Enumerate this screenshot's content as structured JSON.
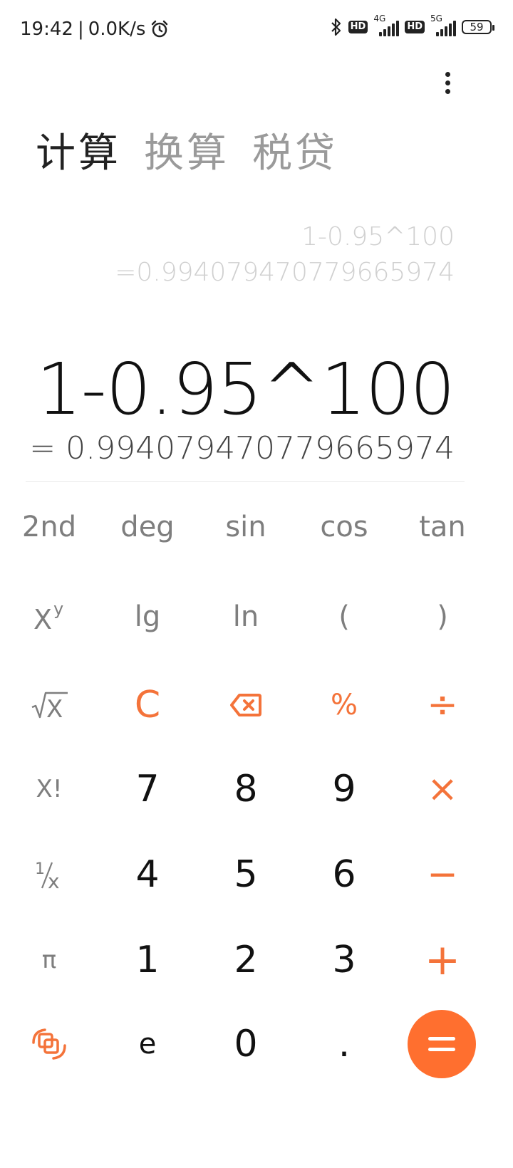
{
  "status_bar": {
    "time": "19:42",
    "separator": "|",
    "net_speed": "0.0K/s",
    "hd_label": "HD",
    "network_1": "4G",
    "network_2": "5G",
    "battery": "59"
  },
  "tabs": [
    {
      "label": "计算",
      "active": true
    },
    {
      "label": "换算",
      "active": false
    },
    {
      "label": "税贷",
      "active": false
    }
  ],
  "history": {
    "expression": "1-0.95^100",
    "result": "=0.994079470779665974"
  },
  "display": {
    "expression": "1-0.95^100",
    "result": "= 0.994079470779665974"
  },
  "keys": {
    "row1": [
      "2nd",
      "deg",
      "sin",
      "cos",
      "tan"
    ],
    "row2": [
      "lg",
      "ln",
      "(",
      ")"
    ],
    "clear": "C",
    "percent": "%",
    "divide": "÷",
    "factorial": "X!",
    "multiply": "×",
    "minus": "−",
    "pi": "π",
    "plus": "+",
    "e": "e",
    "dot": ".",
    "digits": [
      "7",
      "8",
      "9",
      "4",
      "5",
      "6",
      "1",
      "2",
      "3",
      "0"
    ]
  },
  "colors": {
    "accent": "#ff6f2f",
    "operator": "#f4733a"
  },
  "icons": {
    "bluetooth": "bluetooth-icon",
    "alarm": "alarm-icon",
    "menu": "more-vertical-icon",
    "backspace": "backspace-icon",
    "swap_mode": "swap-mode-icon"
  }
}
